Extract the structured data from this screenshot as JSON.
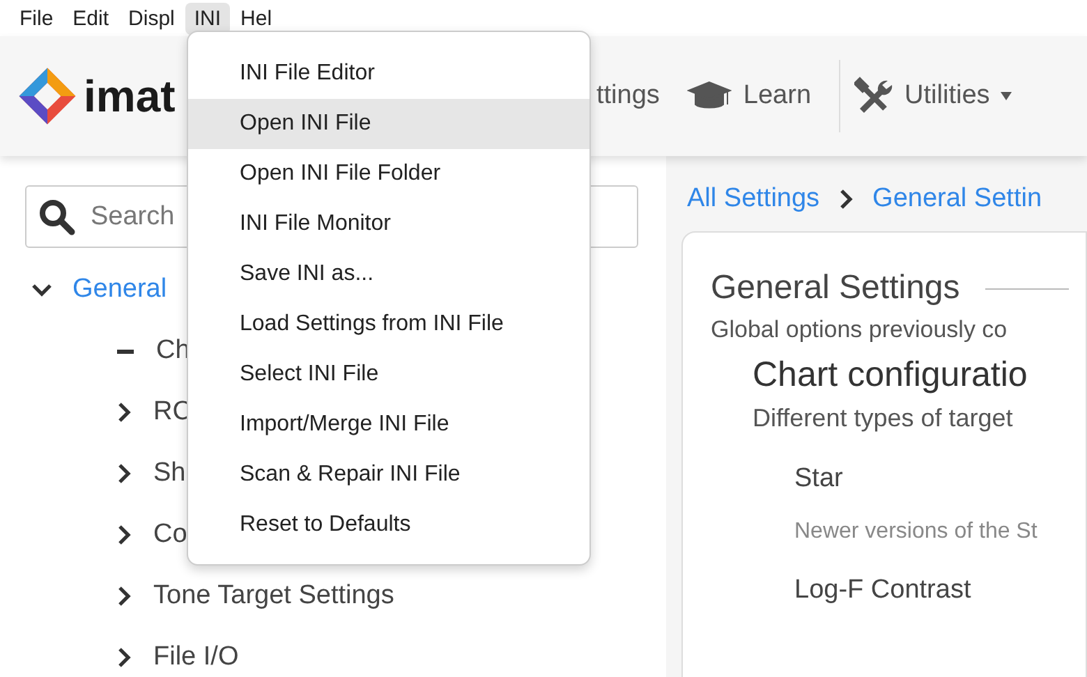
{
  "menubar": [
    {
      "label": "File",
      "selected": false
    },
    {
      "label": "Edit",
      "selected": false
    },
    {
      "label": "Displ",
      "selected": false
    },
    {
      "label": "INI",
      "selected": true
    },
    {
      "label": "Hel",
      "selected": false
    }
  ],
  "logo": {
    "text": "imat"
  },
  "nav_items": [
    {
      "kind": "plain",
      "label": "ttings"
    },
    {
      "kind": "learn",
      "label": "Learn"
    },
    {
      "kind": "utilities",
      "label": "Utilities"
    }
  ],
  "search": {
    "placeholder": "Search"
  },
  "tree": [
    {
      "label": "General",
      "expanded": true,
      "selected": true,
      "children": [
        {
          "kind": "leaf",
          "label": "Ch"
        },
        {
          "kind": "branch",
          "label": "RC"
        },
        {
          "kind": "branch",
          "label": "Sh"
        },
        {
          "kind": "branch",
          "label": "Co"
        },
        {
          "kind": "branch",
          "label": "Tone Target Settings"
        },
        {
          "kind": "branch",
          "label": "File I/O"
        }
      ]
    }
  ],
  "breadcrumb": [
    "All Settings",
    "General Settin"
  ],
  "card": {
    "title": "General Settings",
    "description": "Global options previously co",
    "section": {
      "title": "Chart configuratio",
      "description": "Different types of target",
      "options": [
        {
          "label": "Star",
          "description": "Newer versions of the St"
        },
        {
          "label": "Log-F Contrast"
        }
      ]
    }
  },
  "menu": {
    "items": [
      {
        "label": "INI File Editor",
        "selected": false
      },
      {
        "label": "Open INI File",
        "selected": true
      },
      {
        "label": "Open INI File Folder",
        "selected": false
      },
      {
        "label": "INI File Monitor",
        "selected": false
      },
      {
        "label": "Save INI as...",
        "selected": false
      },
      {
        "label": "Load Settings from INI File",
        "selected": false
      },
      {
        "label": "Select INI File",
        "selected": false
      },
      {
        "label": "Import/Merge INI File",
        "selected": false
      },
      {
        "label": "Scan & Repair INI File",
        "selected": false
      },
      {
        "label": "Reset to Defaults",
        "selected": false
      }
    ]
  }
}
